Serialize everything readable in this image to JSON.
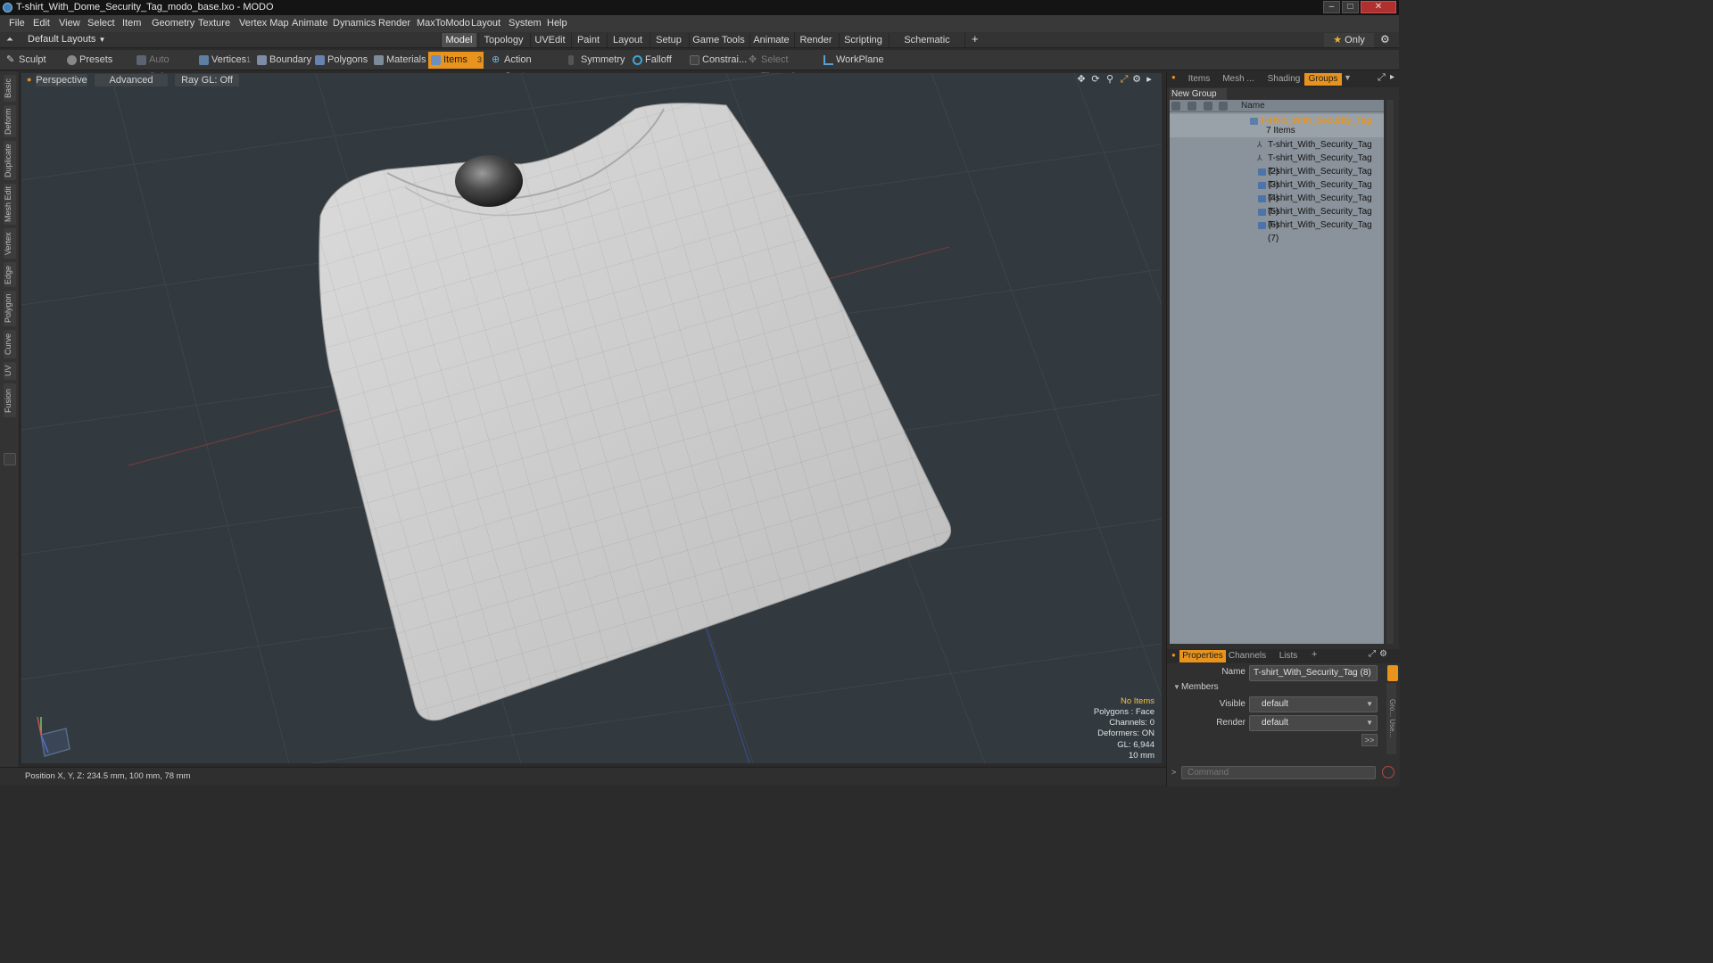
{
  "window": {
    "title": "T-shirt_With_Dome_Security_Tag_modo_base.lxo - MODO"
  },
  "menu": [
    "File",
    "Edit",
    "View",
    "Select",
    "Item",
    "Geometry",
    "Texture",
    "Vertex Map",
    "Animate",
    "Dynamics",
    "Render",
    "MaxToModo",
    "Layout",
    "System",
    "Help"
  ],
  "layout_bar": {
    "layouts_label": "Default Layouts",
    "tabs": [
      "Model",
      "Topology",
      "UVEdit",
      "Paint",
      "Layout",
      "Setup",
      "Game Tools",
      "Animate",
      "Render",
      "Scripting",
      "Schematic Fusion"
    ],
    "active_tab": "Model",
    "only_label": "Only"
  },
  "toolbar": {
    "sculpt": "Sculpt",
    "presets": "Presets",
    "auto_select": "Auto Select",
    "vertices": "Vertices",
    "vertices_count": "1",
    "boundary": "Boundary",
    "polygons": "Polygons",
    "materials": "Materials",
    "items": "Items",
    "items_count": "3",
    "action_center": "Action Center",
    "symmetry": "Symmetry",
    "falloff": "Falloff",
    "constraints": "Constrai...",
    "select_through": "Select Through",
    "workplane": "WorkPlane"
  },
  "left_tabs": [
    "Basic",
    "Deform",
    "Duplicate",
    "Mesh Edit",
    "Vertex",
    "Edge",
    "Polygon",
    "Curve",
    "UV",
    "Fusion"
  ],
  "viewport": {
    "view_mode": "Perspective",
    "shading": "Advanced",
    "raygl": "Ray GL: Off",
    "info": {
      "items": "No Items",
      "polygons": "Polygons : Face",
      "channels": "Channels: 0",
      "deformers": "Deformers: ON",
      "gl": "GL: 6,944",
      "unit": "10 mm"
    }
  },
  "status": {
    "position": "Position X, Y, Z:  234.5 mm, 100 mm, 78 mm"
  },
  "right_panel": {
    "tabs": [
      "Items",
      "Mesh ...",
      "Shading",
      "Groups"
    ],
    "active_tab": "Groups",
    "new_group": "New Group",
    "column_name": "Name",
    "group_name": "T-shirt_With_Security_Tag",
    "group_count": "7 Items",
    "items": [
      "T-shirt_With_Security_Tag",
      "T-shirt_With_Security_Tag (2)",
      "T-shirt_With_Security_Tag (3)",
      "T-shirt_With_Security_Tag (4)",
      "T-shirt_With_Security_Tag (5)",
      "T-shirt_With_Security_Tag (6)",
      "T-shirt_With_Security_Tag (7)"
    ]
  },
  "properties": {
    "tabs": [
      "Properties",
      "Channels",
      "Lists"
    ],
    "active_tab": "Properties",
    "name_label": "Name",
    "name_value": "T-shirt_With_Security_Tag (8)",
    "members_label": "Members",
    "visible_label": "Visible",
    "visible_value": "default",
    "render_label": "Render",
    "render_value": "default",
    "expand": ">>",
    "command_placeholder": "Command"
  },
  "colors": {
    "accent": "#e8931d",
    "viewport_bg": "#323a3f",
    "group_name": "#e8931d"
  }
}
